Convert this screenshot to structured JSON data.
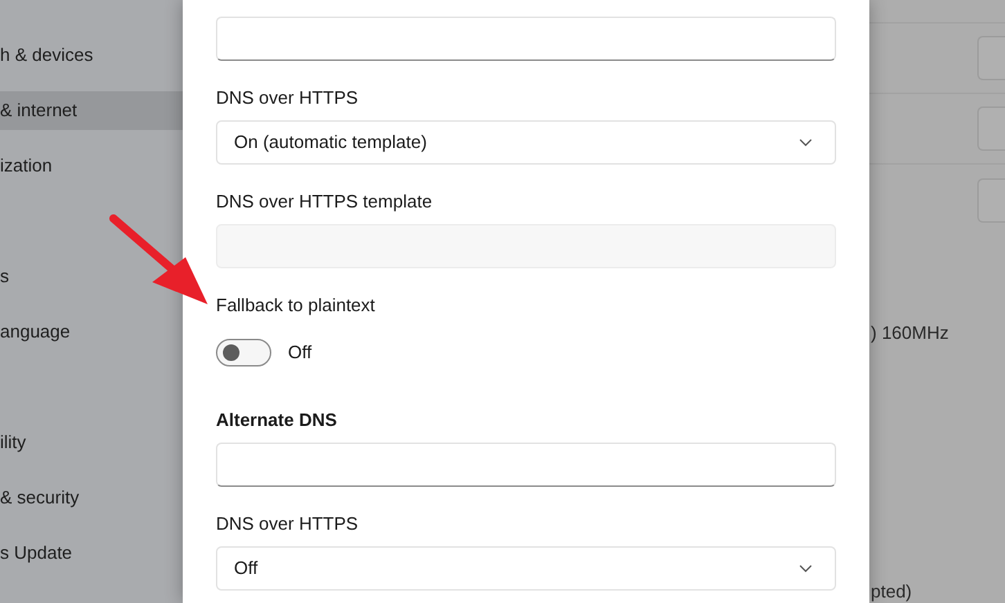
{
  "sidebar": {
    "groups": [
      {
        "items": [
          {
            "label": "h & devices",
            "selected": false
          },
          {
            "label": "& internet",
            "selected": true
          },
          {
            "label": "ization",
            "selected": false
          }
        ]
      },
      {
        "items": [
          {
            "label": "s",
            "selected": false
          },
          {
            "label": "anguage",
            "selected": false
          }
        ]
      },
      {
        "items": [
          {
            "label": "ility",
            "selected": false
          },
          {
            "label": "& security",
            "selected": false
          },
          {
            "label": "s Update",
            "selected": false
          }
        ]
      }
    ]
  },
  "background_pane": {
    "texts": [
      ") 160MHz",
      "pted)"
    ]
  },
  "dialog": {
    "rows": [
      {
        "kind": "field",
        "disabled": false
      },
      {
        "kind": "label",
        "text": "DNS over HTTPS"
      },
      {
        "kind": "dropdown",
        "value": "On (automatic template)"
      },
      {
        "kind": "label",
        "text": "DNS over HTTPS template"
      },
      {
        "kind": "field",
        "disabled": true
      },
      {
        "kind": "label",
        "text": "Fallback to plaintext"
      },
      {
        "kind": "toggle",
        "on": false,
        "text": "Off"
      },
      {
        "kind": "heading",
        "text": "Alternate DNS"
      },
      {
        "kind": "field",
        "disabled": false
      },
      {
        "kind": "label",
        "text": "DNS over HTTPS"
      },
      {
        "kind": "dropdown",
        "value": "Off"
      }
    ]
  }
}
